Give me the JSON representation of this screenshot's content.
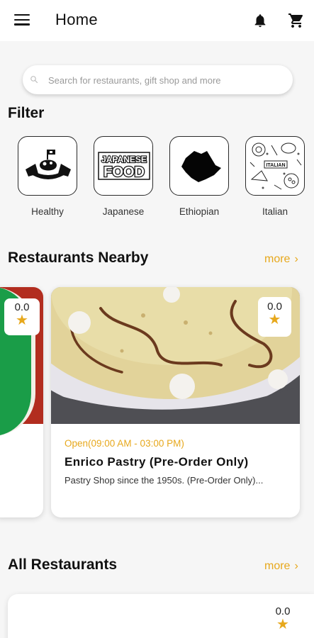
{
  "header": {
    "title": "Home",
    "menu_icon": "hamburger-menu-icon",
    "notification_icon": "bell-icon",
    "cart_icon": "shopping-cart-icon"
  },
  "search": {
    "placeholder": "Search for restaurants, gift shop and more",
    "value": ""
  },
  "filter": {
    "title": "Filter",
    "categories": [
      {
        "label": "Healthy"
      },
      {
        "label": "Japanese"
      },
      {
        "label": "Ethiopian"
      },
      {
        "label": "Italian"
      }
    ],
    "japanese_logo_lines": [
      "JAPANESE",
      "FOOD"
    ],
    "italian_logo_text": "ITALIAN"
  },
  "nearby": {
    "title": "Restaurants Nearby",
    "more_label": "more",
    "left_card": {
      "rating": "0.0"
    },
    "main_card": {
      "rating": "0.0",
      "open_hours": "Open(09:00 AM - 03:00 PM)",
      "name": "Enrico Pastry (Pre-Order Only)",
      "description": "Pastry Shop since the 1950s. (Pre-Order Only)..."
    }
  },
  "all_restaurants": {
    "title": "All Restaurants",
    "more_label": "more",
    "first_card": {
      "rating": "0.0"
    }
  },
  "colors": {
    "accent": "#e7a81c",
    "background": "#f6f6f6",
    "card": "#ffffff",
    "text": "#111111"
  }
}
